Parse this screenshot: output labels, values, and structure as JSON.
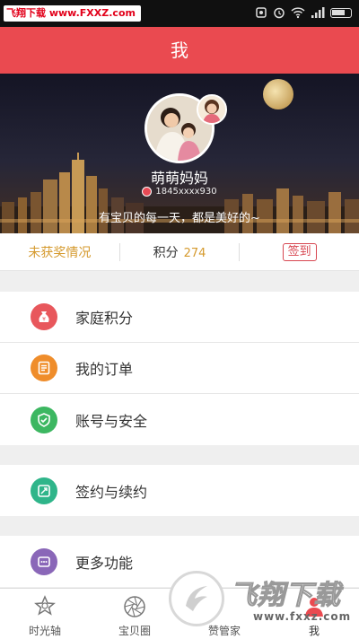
{
  "status_bar": {
    "watermark": "飞翔下载 www.FXXZ.com",
    "icons": [
      "nfc-icon",
      "alarm-icon",
      "wifi-icon",
      "signal-icon",
      "battery-icon"
    ]
  },
  "header": {
    "title": "我"
  },
  "profile": {
    "nickname": "萌萌妈妈",
    "phone": "1845xxxx930",
    "motto": "有宝贝的每一天，都是美好的~"
  },
  "stats": {
    "award_label": "未获奖情况",
    "points_label": "积分",
    "points_value": "274",
    "checkin_label": "签到"
  },
  "menu": {
    "group1": [
      {
        "label": "家庭积分",
        "icon": "money-bag-icon",
        "color": "#e8575c"
      },
      {
        "label": "我的订单",
        "icon": "order-list-icon",
        "color": "#ef8d2b"
      },
      {
        "label": "账号与安全",
        "icon": "shield-icon",
        "color": "#3cb761"
      }
    ],
    "group2": [
      {
        "label": "签约与续约",
        "icon": "contract-icon",
        "color": "#2fb58a"
      }
    ],
    "group3": [
      {
        "label": "更多功能",
        "icon": "more-icon",
        "color": "#8a67b8"
      }
    ]
  },
  "tabbar": {
    "tabs": [
      {
        "label": "时光轴",
        "icon": "timeline-icon"
      },
      {
        "label": "宝贝圈",
        "icon": "aperture-icon"
      },
      {
        "label": "赞管家",
        "icon": "thumb-icon"
      },
      {
        "label": "我",
        "icon": "profile-icon"
      }
    ]
  },
  "watermark": {
    "text": "飞翔下载",
    "url": "www.fxxz.com"
  },
  "colors": {
    "accent": "#ea4a50",
    "gold": "#d59a2e"
  }
}
